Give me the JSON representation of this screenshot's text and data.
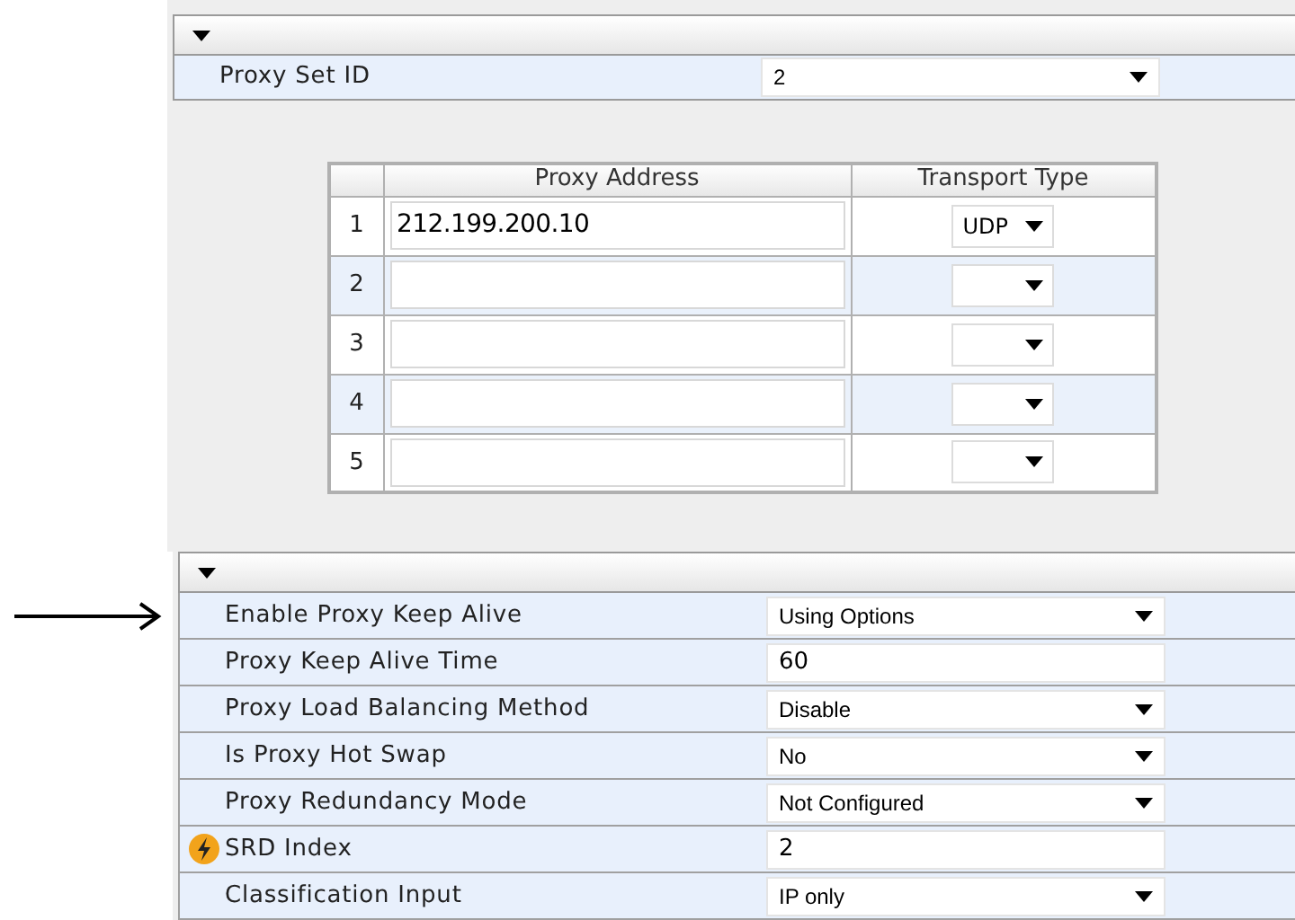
{
  "proxy_set_section": {
    "expanded": true,
    "rows": [
      {
        "label": "Proxy Set ID",
        "kind": "select",
        "value": "2"
      }
    ]
  },
  "proxy_table": {
    "columns": [
      "Proxy Address",
      "Transport Type"
    ],
    "rows": [
      {
        "index": "1",
        "address": "212.199.200.10",
        "transport": "UDP"
      },
      {
        "index": "2"
      },
      {
        "index": "3"
      },
      {
        "index": "4"
      },
      {
        "index": "5"
      }
    ]
  },
  "settings_section": {
    "expanded": true,
    "rows": [
      {
        "label": "Enable Proxy Keep Alive",
        "kind": "select",
        "value": "Using Options",
        "lightning": false,
        "pointed": true
      },
      {
        "label": "Proxy Keep Alive Time",
        "kind": "text",
        "value": "60",
        "lightning": false,
        "pointed": false
      },
      {
        "label": "Proxy Load Balancing Method",
        "kind": "select",
        "value": "Disable",
        "lightning": false,
        "pointed": false
      },
      {
        "label": "Is Proxy Hot Swap",
        "kind": "select",
        "value": "No",
        "lightning": false,
        "pointed": false
      },
      {
        "label": "Proxy Redundancy Mode",
        "kind": "select",
        "value": "Not Configured",
        "lightning": false,
        "pointed": false
      },
      {
        "label": "SRD Index",
        "kind": "text",
        "value": "2",
        "lightning": true,
        "pointed": false
      },
      {
        "label": "Classification Input",
        "kind": "select",
        "value": "IP only",
        "lightning": false,
        "pointed": false
      }
    ]
  }
}
